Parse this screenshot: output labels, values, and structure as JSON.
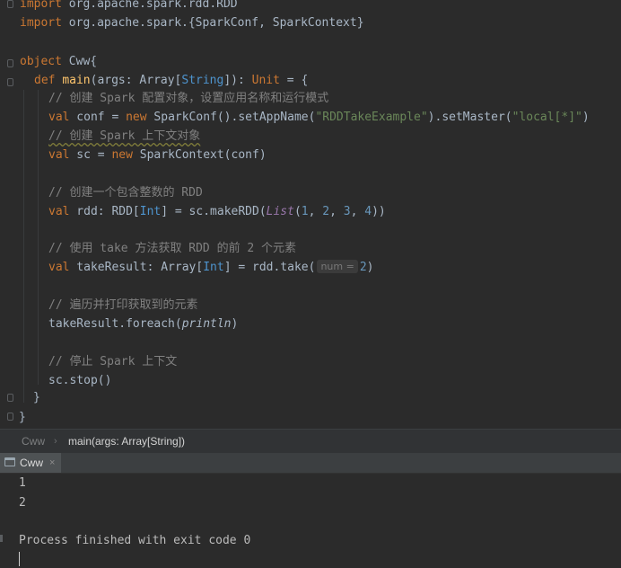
{
  "editor": {
    "imports": {
      "line1_kw": "import",
      "line1_path": " org.apache.spark.rdd.RDD",
      "line2_kw": "import",
      "line2_path": " org.apache.spark.{SparkConf, SparkContext}"
    },
    "object_kw": "object",
    "object_name": " Cww{",
    "def_kw": "def",
    "main_fn": "main",
    "main_args": "(args: Array[",
    "string_type": "String",
    "main_mid": "]): ",
    "unit_type": "Unit",
    "main_end": " = {",
    "comment_conf": "// 创建 Spark 配置对象，设置应用名称和运行模式",
    "val_kw": "val",
    "conf_decl": " conf = ",
    "new_kw": "new",
    "conf_call": " SparkConf().setAppName(",
    "app_name": "\"RDDTakeExample\"",
    "conf_mid": ").setMaster(",
    "master": "\"local[*]\"",
    "conf_end": ")",
    "comment_ctx": "// 创建 Spark 上下文对象",
    "sc_decl": " sc = ",
    "sc_call": " SparkContext(conf)",
    "comment_rdd": "// 创建一个包含整数的 RDD",
    "rdd_decl": " rdd: RDD[",
    "int_type": "Int",
    "rdd_mid": "] = sc.makeRDD(",
    "list_fn": "List",
    "open_paren": "(",
    "n1": "1",
    "n2": "2",
    "n3": "3",
    "n4": "4",
    "comma": ", ",
    "rdd_end": "))",
    "comment_take": "// 使用 take 方法获取 RDD 的前 2 个元素",
    "take_decl": " takeResult: Array[",
    "take_mid": "] = rdd.take(",
    "param_hint": "num =",
    "take_arg": "2",
    "take_end": ")",
    "comment_loop": "// 遍历并打印获取到的元素",
    "foreach_call": "takeResult.foreach(",
    "println_fn": "println",
    "foreach_end": ")",
    "comment_stop": "// 停止 Spark 上下文",
    "stop_call": "sc.stop()",
    "close_inner": "}",
    "close_outer": "}"
  },
  "breadcrumb": {
    "object": "Cww",
    "separator": "›",
    "method": "main(args: Array[String])"
  },
  "run_panel": {
    "tab_label": "Cww",
    "tab_close": "×",
    "output": [
      "1",
      "2",
      "",
      "Process finished with exit code 0"
    ]
  },
  "colors": {
    "background": "#2b2b2b",
    "keyword": "#cc7832",
    "function": "#ffc66d",
    "type": "#4e94ce",
    "string": "#6a8759",
    "number": "#6897bb",
    "comment": "#808080"
  }
}
